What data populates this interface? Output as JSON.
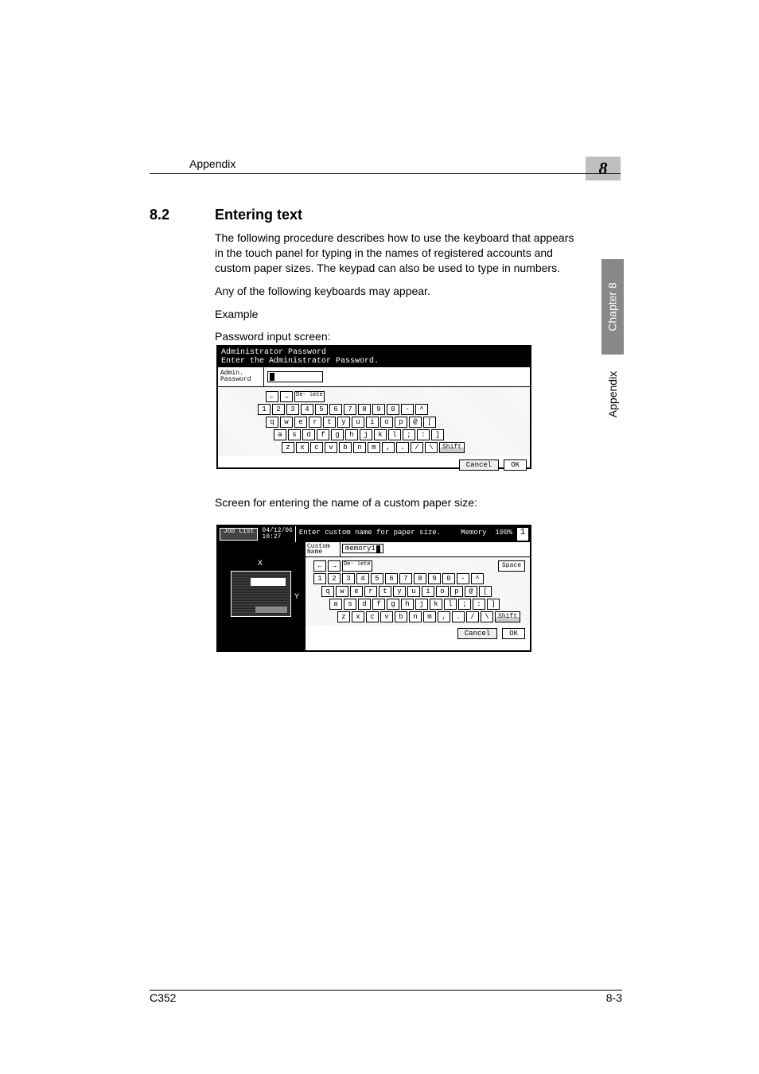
{
  "header": {
    "section": "Appendix",
    "chapter_badge": "8"
  },
  "side": {
    "tab": "Chapter 8",
    "label": "Appendix"
  },
  "section": {
    "number": "8.2",
    "title": "Entering text"
  },
  "paragraphs": {
    "p1": "The following procedure describes how to use the keyboard that appears in the touch panel for typing in the names of registered accounts and custom paper sizes. The keypad can also be used to type in numbers.",
    "p2": "Any of the following keyboards may appear.",
    "p3": "Example",
    "p4": "Password input screen:",
    "p5": "Screen for entering the name of a custom paper size:"
  },
  "panel1": {
    "title_line1": "Administrator Password",
    "title_line2": "Enter the Administrator Password.",
    "field_label": "Admin. Password",
    "keys_nav": {
      "left": "←",
      "right": "→",
      "del": "De- lete"
    },
    "rows": {
      "r1": [
        "1",
        "2",
        "3",
        "4",
        "5",
        "6",
        "7",
        "8",
        "9",
        "0",
        "-",
        "^"
      ],
      "r2": [
        "q",
        "w",
        "e",
        "r",
        "t",
        "y",
        "u",
        "i",
        "o",
        "p",
        "@",
        "["
      ],
      "r3": [
        "a",
        "s",
        "d",
        "f",
        "g",
        "h",
        "j",
        "k",
        "l",
        ";",
        ":",
        "]"
      ],
      "r4": [
        "z",
        "x",
        "c",
        "v",
        "b",
        "n",
        "m",
        ",",
        ".",
        "/",
        "\\"
      ]
    },
    "shift": "Shift",
    "cancel": "Cancel",
    "ok": "OK"
  },
  "panel2": {
    "job": "Job List",
    "date": "04/12/06",
    "time": "10:27",
    "prompt": "Enter custom name for paper size.",
    "memory_label": "Memory",
    "memory_value": "100%",
    "page_num": "1",
    "axis_x": "X",
    "axis_y": "Y",
    "custom_label": "Custom Name",
    "custom_value": "memory1",
    "keys_nav": {
      "left": "←",
      "right": "→",
      "del": "De- lete",
      "space": "Space"
    },
    "rows": {
      "r1": [
        "1",
        "2",
        "3",
        "4",
        "5",
        "6",
        "7",
        "8",
        "9",
        "0",
        "-",
        "^"
      ],
      "r2": [
        "q",
        "w",
        "e",
        "r",
        "t",
        "y",
        "u",
        "i",
        "o",
        "p",
        "@",
        "["
      ],
      "r3": [
        "a",
        "s",
        "d",
        "f",
        "g",
        "h",
        "j",
        "k",
        "l",
        ";",
        ":",
        "]"
      ],
      "r4": [
        "z",
        "x",
        "c",
        "v",
        "b",
        "n",
        "m",
        ",",
        ".",
        "/",
        "\\"
      ]
    },
    "shift": "Shift",
    "cancel": "Cancel",
    "ok": "OK"
  },
  "footer": {
    "left": "C352",
    "right": "8-3"
  }
}
